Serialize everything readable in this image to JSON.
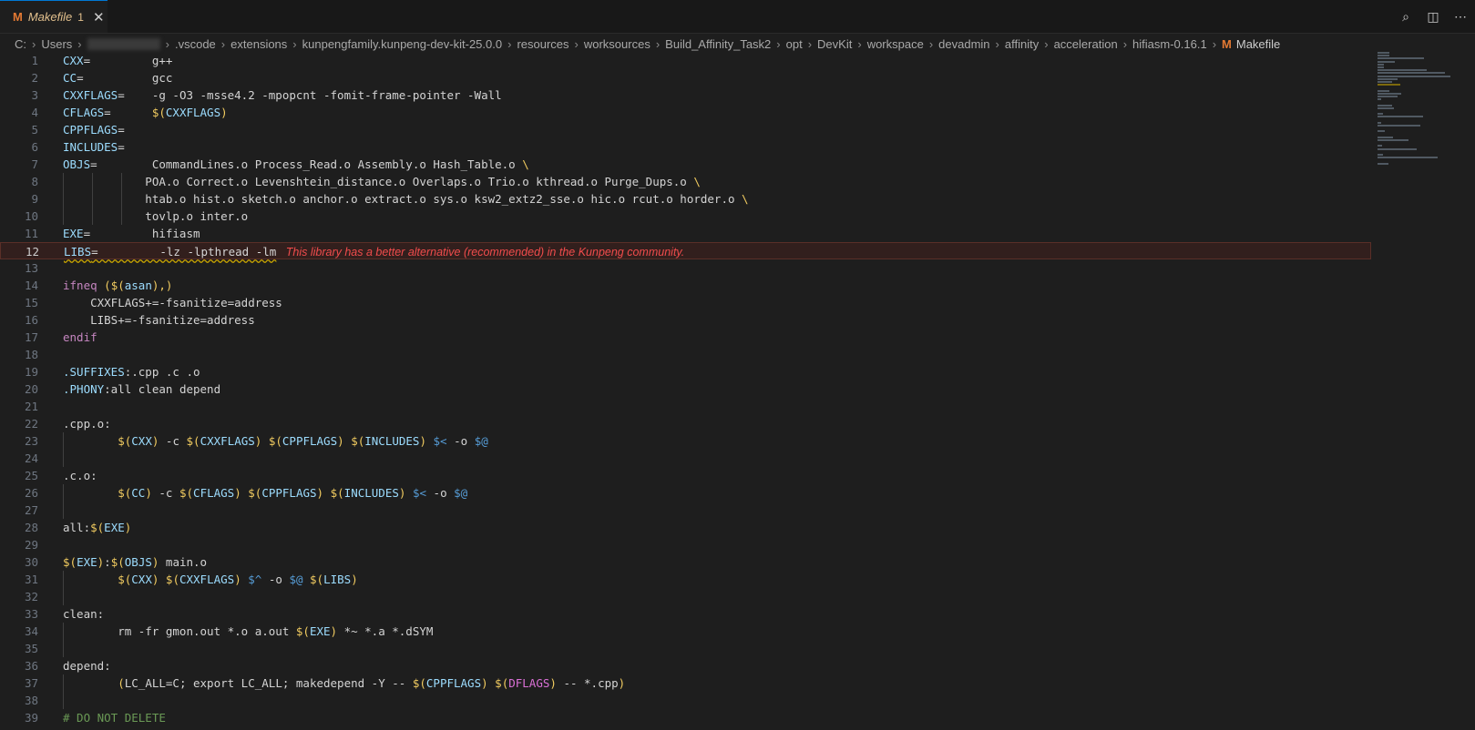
{
  "tab": {
    "letter": "M",
    "name": "Makefile",
    "badge": "1",
    "close": "✕"
  },
  "actions": [
    {
      "name": "search-icon",
      "glyph": "⌕"
    },
    {
      "name": "split-editor-icon",
      "glyph": "◫"
    },
    {
      "name": "more-actions-icon",
      "glyph": "⋯"
    }
  ],
  "breadcrumb": [
    "C:",
    "Users",
    "",
    ".vscode",
    "extensions",
    "kunpengfamily.kunpeng-dev-kit-25.0.0",
    "resources",
    "worksources",
    "Build_Affinity_Task2",
    "opt",
    "DevKit",
    "workspace",
    "devadmin",
    "affinity",
    "acceleration",
    "hifiasm-0.16.1",
    "Makefile"
  ],
  "breadcrumb_sep": "›",
  "active_line": 12,
  "diagnostic": "This library has a better alternative (recommended) in the Kunpeng community.",
  "lines": [
    [
      [
        "v",
        "CXX"
      ],
      [
        "w",
        "=         g++"
      ]
    ],
    [
      [
        "v",
        "CC"
      ],
      [
        "w",
        "=          gcc"
      ]
    ],
    [
      [
        "v",
        "CXXFLAGS"
      ],
      [
        "w",
        "=    -g -O3 -msse4.2 -mpopcnt -fomit-frame-pointer -Wall"
      ]
    ],
    [
      [
        "v",
        "CFLAGS"
      ],
      [
        "w",
        "=      "
      ],
      [
        "d",
        "$("
      ],
      [
        "pv",
        "CXXFLAGS"
      ],
      [
        "d",
        ")"
      ]
    ],
    [
      [
        "v",
        "CPPFLAGS"
      ],
      [
        "w",
        "="
      ]
    ],
    [
      [
        "v",
        "INCLUDES"
      ],
      [
        "w",
        "="
      ]
    ],
    [
      [
        "v",
        "OBJS"
      ],
      [
        "w",
        "=        CommandLines.o Process_Read.o Assembly.o Hash_Table.o "
      ],
      [
        "d",
        "\\"
      ]
    ],
    [
      [
        "w",
        "            POA.o Correct.o Levenshtein_distance.o Overlaps.o Trio.o kthread.o Purge_Dups.o "
      ],
      [
        "d",
        "\\"
      ]
    ],
    [
      [
        "w",
        "            htab.o hist.o sketch.o anchor.o extract.o sys.o ksw2_extz2_sse.o hic.o rcut.o horder.o "
      ],
      [
        "d",
        "\\"
      ]
    ],
    [
      [
        "w",
        "            tovlp.o inter.o"
      ]
    ],
    [
      [
        "v",
        "EXE"
      ],
      [
        "w",
        "=         hifiasm"
      ]
    ],
    [
      [
        "vs",
        "LIBS"
      ],
      [
        "ws",
        "=         -lz -lpthread -lm"
      ]
    ],
    [],
    [
      [
        "k",
        "ifneq"
      ],
      [
        "w",
        " "
      ],
      [
        "d",
        "($("
      ],
      [
        "pv",
        "asan"
      ],
      [
        "d",
        "),)"
      ]
    ],
    [
      [
        "w",
        "    CXXFLAGS+=-fsanitize=address"
      ]
    ],
    [
      [
        "w",
        "    LIBS+=-fsanitize=address"
      ]
    ],
    [
      [
        "k",
        "endif"
      ]
    ],
    [],
    [
      [
        "v",
        ".SUFFIXES"
      ],
      [
        "w",
        ":.cpp .c .o"
      ]
    ],
    [
      [
        "v",
        ".PHONY"
      ],
      [
        "w",
        ":all clean depend"
      ]
    ],
    [],
    [
      [
        "w",
        ".cpp.o:"
      ]
    ],
    [
      [
        "w",
        "        "
      ],
      [
        "d",
        "$("
      ],
      [
        "pv",
        "CXX"
      ],
      [
        "d",
        ")"
      ],
      [
        "w",
        " -c "
      ],
      [
        "d",
        "$("
      ],
      [
        "pv",
        "CXXFLAGS"
      ],
      [
        "d",
        ")"
      ],
      [
        "w",
        " "
      ],
      [
        "d",
        "$("
      ],
      [
        "pv",
        "CPPFLAGS"
      ],
      [
        "d",
        ")"
      ],
      [
        "w",
        " "
      ],
      [
        "d",
        "$("
      ],
      [
        "pv",
        "INCLUDES"
      ],
      [
        "d",
        ")"
      ],
      [
        "w",
        " "
      ],
      [
        "o",
        "$<"
      ],
      [
        "w",
        " -o "
      ],
      [
        "o",
        "$@"
      ]
    ],
    [],
    [
      [
        "w",
        ".c.o:"
      ]
    ],
    [
      [
        "w",
        "        "
      ],
      [
        "d",
        "$("
      ],
      [
        "pv",
        "CC"
      ],
      [
        "d",
        ")"
      ],
      [
        "w",
        " -c "
      ],
      [
        "d",
        "$("
      ],
      [
        "pv",
        "CFLAGS"
      ],
      [
        "d",
        ")"
      ],
      [
        "w",
        " "
      ],
      [
        "d",
        "$("
      ],
      [
        "pv",
        "CPPFLAGS"
      ],
      [
        "d",
        ")"
      ],
      [
        "w",
        " "
      ],
      [
        "d",
        "$("
      ],
      [
        "pv",
        "INCLUDES"
      ],
      [
        "d",
        ")"
      ],
      [
        "w",
        " "
      ],
      [
        "o",
        "$<"
      ],
      [
        "w",
        " -o "
      ],
      [
        "o",
        "$@"
      ]
    ],
    [],
    [
      [
        "w",
        "all:"
      ],
      [
        "d",
        "$("
      ],
      [
        "pv",
        "EXE"
      ],
      [
        "d",
        ")"
      ]
    ],
    [],
    [
      [
        "d",
        "$("
      ],
      [
        "pv",
        "EXE"
      ],
      [
        "d",
        ")"
      ],
      [
        "w",
        ":"
      ],
      [
        "d",
        "$("
      ],
      [
        "pv",
        "OBJS"
      ],
      [
        "d",
        ")"
      ],
      [
        "w",
        " main.o"
      ]
    ],
    [
      [
        "w",
        "        "
      ],
      [
        "d",
        "$("
      ],
      [
        "pv",
        "CXX"
      ],
      [
        "d",
        ")"
      ],
      [
        "w",
        " "
      ],
      [
        "d",
        "$("
      ],
      [
        "pv",
        "CXXFLAGS"
      ],
      [
        "d",
        ")"
      ],
      [
        "w",
        " "
      ],
      [
        "o",
        "$^"
      ],
      [
        "w",
        " -o "
      ],
      [
        "o",
        "$@"
      ],
      [
        "w",
        " "
      ],
      [
        "d",
        "$("
      ],
      [
        "pv",
        "LIBS"
      ],
      [
        "d",
        ")"
      ]
    ],
    [],
    [
      [
        "w",
        "clean:"
      ]
    ],
    [
      [
        "w",
        "        rm -fr gmon.out *.o a.out "
      ],
      [
        "d",
        "$("
      ],
      [
        "pv",
        "EXE"
      ],
      [
        "d",
        ")"
      ],
      [
        "w",
        " *~ *.a *.dSYM"
      ]
    ],
    [],
    [
      [
        "w",
        "depend:"
      ]
    ],
    [
      [
        "w",
        "        "
      ],
      [
        "d",
        "("
      ],
      [
        "w",
        "LC_ALL=C; export LC_ALL; makedepend -Y -- "
      ],
      [
        "d",
        "$("
      ],
      [
        "pv",
        "CPPFLAGS"
      ],
      [
        "d",
        ")"
      ],
      [
        "w",
        " "
      ],
      [
        "d",
        "$("
      ],
      [
        "p",
        "DFLAGS"
      ],
      [
        "d",
        ")"
      ],
      [
        "w",
        " -- *.cpp"
      ],
      [
        "d",
        ")"
      ]
    ],
    [],
    [
      [
        "c",
        "# DO NOT DELETE"
      ]
    ]
  ],
  "colors": {
    "accent": "#0078d4",
    "background": "#1e1e1e",
    "error": "#f14c4c",
    "warning": "#cca700"
  }
}
